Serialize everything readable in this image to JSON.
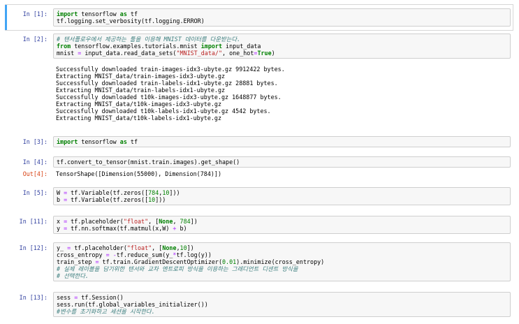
{
  "cells": [
    {
      "prompt": "In [1]:",
      "code": [
        [
          [
            "kw",
            "import"
          ],
          [
            "t",
            " tensorflow "
          ],
          [
            "kw",
            "as"
          ],
          [
            "t",
            " tf"
          ]
        ],
        [
          [
            "t",
            "tf.logging.set_verbosity(tf.logging.ERROR)"
          ]
        ]
      ]
    },
    {
      "prompt": "In [2]:",
      "code": [
        [
          [
            "cm",
            "# 텐서플로우에서 제공하는 툴을 이용해 MNIST 데이터를 다운받는다."
          ]
        ],
        [
          [
            "kw",
            "from"
          ],
          [
            "t",
            " tensorflow.examples.tutorials.mnist "
          ],
          [
            "kw",
            "import"
          ],
          [
            "t",
            " input_data"
          ]
        ],
        [
          [
            "t",
            "mnist "
          ],
          [
            "op",
            "="
          ],
          [
            "t",
            " input_data.read_data_sets("
          ],
          [
            "str",
            "\"MNIST_data/\""
          ],
          [
            "t",
            ", one_hot"
          ],
          [
            "op",
            "="
          ],
          [
            "kw",
            "True"
          ],
          [
            "t",
            ")"
          ]
        ]
      ],
      "output": [
        "Successfully downloaded train-images-idx3-ubyte.gz 9912422 bytes.",
        "Extracting MNIST_data/train-images-idx3-ubyte.gz",
        "Successfully downloaded train-labels-idx1-ubyte.gz 28881 bytes.",
        "Extracting MNIST_data/train-labels-idx1-ubyte.gz",
        "Successfully downloaded t10k-images-idx3-ubyte.gz 1648877 bytes.",
        "Extracting MNIST_data/t10k-images-idx3-ubyte.gz",
        "Successfully downloaded t10k-labels-idx1-ubyte.gz 4542 bytes.",
        "Extracting MNIST_data/t10k-labels-idx1-ubyte.gz"
      ]
    },
    {
      "prompt": "In [3]:",
      "code": [
        [
          [
            "kw",
            "import"
          ],
          [
            "t",
            " tensorflow "
          ],
          [
            "kw",
            "as"
          ],
          [
            "t",
            " tf"
          ]
        ]
      ]
    },
    {
      "prompt": "In [4]:",
      "code": [
        [
          [
            "t",
            "tf.convert_to_tensor(mnist.train.images).get_shape()"
          ]
        ]
      ],
      "out_prompt": "Out[4]:",
      "output": [
        "TensorShape([Dimension(55000), Dimension(784)])"
      ]
    },
    {
      "prompt": "In [5]:",
      "code": [
        [
          [
            "t",
            "W "
          ],
          [
            "op",
            "="
          ],
          [
            "t",
            " tf.Variable(tf.zeros(["
          ],
          [
            "num",
            "784"
          ],
          [
            "t",
            ","
          ],
          [
            "num",
            "10"
          ],
          [
            "t",
            "]))"
          ]
        ],
        [
          [
            "t",
            "b "
          ],
          [
            "op",
            "="
          ],
          [
            "t",
            " tf.Variable(tf.zeros(["
          ],
          [
            "num",
            "10"
          ],
          [
            "t",
            "]))"
          ]
        ]
      ]
    },
    {
      "prompt": "In [11]:",
      "code": [
        [
          [
            "t",
            "x "
          ],
          [
            "op",
            "="
          ],
          [
            "t",
            " tf.placeholder("
          ],
          [
            "str",
            "\"float\""
          ],
          [
            "t",
            ", ["
          ],
          [
            "kw",
            "None"
          ],
          [
            "t",
            ", "
          ],
          [
            "num",
            "784"
          ],
          [
            "t",
            "])"
          ]
        ],
        [
          [
            "t",
            "y "
          ],
          [
            "op",
            "="
          ],
          [
            "t",
            " tf.nn.softmax(tf.matmul(x,W) "
          ],
          [
            "op",
            "+"
          ],
          [
            "t",
            " b)"
          ]
        ]
      ]
    },
    {
      "prompt": "In [12]:",
      "code": [
        [
          [
            "t",
            "y_ "
          ],
          [
            "op",
            "="
          ],
          [
            "t",
            " tf.placeholder("
          ],
          [
            "str",
            "\"float\""
          ],
          [
            "t",
            ", ["
          ],
          [
            "kw",
            "None"
          ],
          [
            "t",
            ","
          ],
          [
            "num",
            "10"
          ],
          [
            "t",
            "])"
          ]
        ],
        [
          [
            "t",
            "cross_entropy "
          ],
          [
            "op",
            "="
          ],
          [
            "t",
            " "
          ],
          [
            "op",
            "-"
          ],
          [
            "t",
            "tf.reduce_sum(y_"
          ],
          [
            "op",
            "*"
          ],
          [
            "t",
            "tf.log(y))"
          ]
        ],
        [
          [
            "t",
            "train_step "
          ],
          [
            "op",
            "="
          ],
          [
            "t",
            " tf.train.GradientDescentOptimizer("
          ],
          [
            "num",
            "0.01"
          ],
          [
            "t",
            ").minimize(cross_entropy)"
          ]
        ],
        [
          [
            "cm",
            "# 실제 레이블을 담기위한 텐서와 교차 엔트로피 방식을 이용하는 그레디언트 디센트 방식을"
          ]
        ],
        [
          [
            "cm",
            "# 선택한다."
          ]
        ]
      ]
    },
    {
      "prompt": "In [13]:",
      "code": [
        [
          [
            "t",
            "sess "
          ],
          [
            "op",
            "="
          ],
          [
            "t",
            " tf.Session()"
          ]
        ],
        [
          [
            "t",
            "sess.run(tf.global_variables_initializer())"
          ]
        ],
        [
          [
            "cm",
            "#변수를 초기화하고 세션을 시작한다."
          ]
        ]
      ]
    }
  ]
}
